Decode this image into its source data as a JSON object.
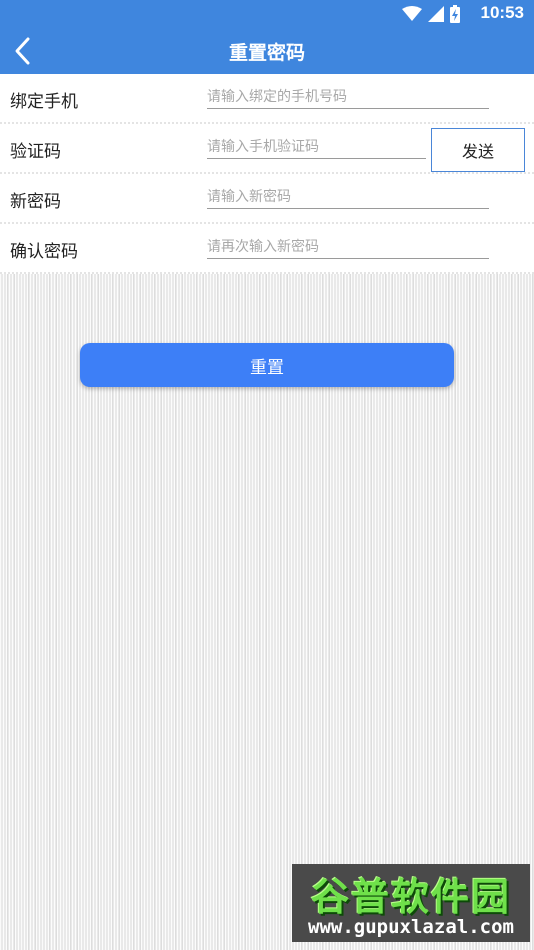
{
  "status_bar": {
    "time": "10:53",
    "icons": [
      "wifi-icon",
      "signal-icon",
      "battery-icon"
    ]
  },
  "app_bar": {
    "title": "重置密码",
    "back_icon": "chevron-left-icon"
  },
  "form": {
    "rows": [
      {
        "label": "绑定手机",
        "placeholder": "请输入绑定的手机号码",
        "value": ""
      },
      {
        "label": "验证码",
        "placeholder": "请输入手机验证码",
        "value": ""
      },
      {
        "label": "新密码",
        "placeholder": "请输入新密码",
        "value": ""
      },
      {
        "label": "确认密码",
        "placeholder": "请再次输入新密码",
        "value": ""
      }
    ],
    "send_button_label": "发送"
  },
  "reset_button_label": "重置",
  "watermark": {
    "brand": "谷普软件园",
    "url": "www.gupuxlazal.com"
  },
  "colors": {
    "app_bar": "#3f86de",
    "primary_button": "#3d7ff7",
    "send_button_border": "#4a86d8"
  }
}
